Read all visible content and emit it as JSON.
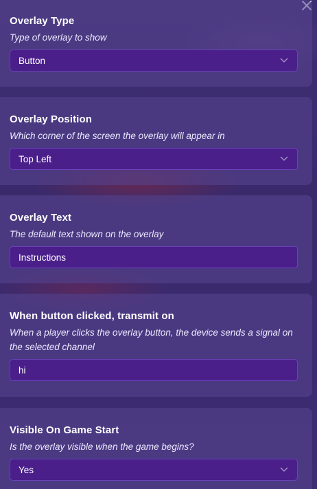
{
  "sections": [
    {
      "title": "Overlay Type",
      "description": "Type of overlay to show",
      "value": "Button"
    },
    {
      "title": "Overlay Position",
      "description": "Which corner of the screen the overlay will appear in",
      "value": "Top Left"
    },
    {
      "title": "Overlay Text",
      "description": "The default text shown on the overlay",
      "value": "Instructions"
    },
    {
      "title": "When button clicked, transmit on",
      "description": "When a player clicks the overlay button, the device sends a signal on the selected channel",
      "value": "hi"
    },
    {
      "title": "Visible On Game Start",
      "description": "Is the overlay visible when the game begins?",
      "value": "Yes"
    }
  ],
  "icons": {
    "close": "close-icon",
    "dropdown": "chevron-down-icon"
  }
}
